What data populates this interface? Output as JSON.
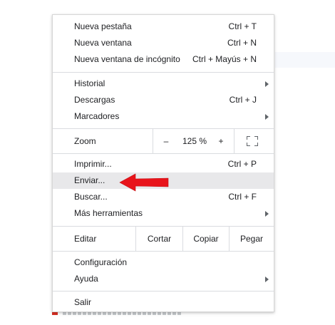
{
  "menu": {
    "group1": [
      {
        "label": "Nueva pestaña",
        "shortcut": "Ctrl + T"
      },
      {
        "label": "Nueva ventana",
        "shortcut": "Ctrl + N"
      },
      {
        "label": "Nueva ventana de incógnito",
        "shortcut": "Ctrl + Mayús + N"
      }
    ],
    "group2": [
      {
        "label": "Historial"
      },
      {
        "label": "Descargas",
        "shortcut": "Ctrl + J"
      },
      {
        "label": "Marcadores"
      }
    ],
    "zoom": {
      "label": "Zoom",
      "minus": "–",
      "value": "125 %",
      "plus": "+",
      "fullscreen_icon": "fullscreen-icon"
    },
    "group3": [
      {
        "label": "Imprimir...",
        "shortcut": "Ctrl + P"
      },
      {
        "label": "Enviar...",
        "highlighted": true
      },
      {
        "label": "Buscar...",
        "shortcut": "Ctrl + F"
      },
      {
        "label": "Más herramientas"
      }
    ],
    "edit": {
      "label": "Editar",
      "cut": "Cortar",
      "copy": "Copiar",
      "paste": "Pegar"
    },
    "group4": [
      {
        "label": "Configuración"
      },
      {
        "label": "Ayuda"
      }
    ],
    "exit": {
      "label": "Salir"
    }
  },
  "annotation": {
    "arrow_color": "#e8141b",
    "icon": "red-pointer-arrow-icon"
  },
  "colors": {
    "highlight": "#e8e8ea",
    "separator": "#dadce0",
    "text": "#202124"
  }
}
